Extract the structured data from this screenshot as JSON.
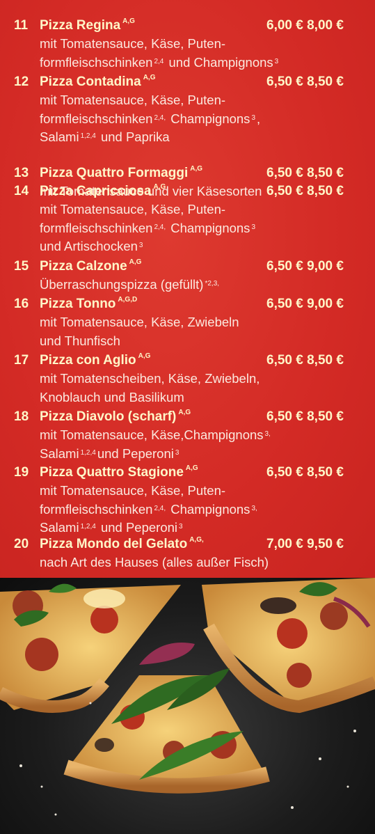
{
  "items": [
    {
      "num": "11",
      "name": "Pizza Regina",
      "allergens": "A,G",
      "price": "6,00 € 8,00 €",
      "lines": [
        [
          {
            "t": "mit Tomatensauce, Käse, Puten-"
          }
        ],
        [
          {
            "t": "formfleischschinken"
          },
          {
            "s": "2,4"
          },
          {
            "t": " und Champignons"
          },
          {
            "s": "3"
          }
        ]
      ]
    },
    {
      "num": "12",
      "name": "Pizza Contadina",
      "allergens": "A,G",
      "price": "6,50 € 8,50 €",
      "lines": [
        [
          {
            "t": "mit Tomatensauce, Käse, Puten-"
          }
        ],
        [
          {
            "t": "formfleischschinken"
          },
          {
            "s": "2,4,"
          },
          {
            "t": " Champignons"
          },
          {
            "s": "3"
          },
          {
            "t": ","
          }
        ],
        [
          {
            "t": "Salami"
          },
          {
            "s": "1,2,4"
          },
          {
            "t": " und Paprika"
          }
        ]
      ]
    },
    {
      "num": "13",
      "name": "Pizza Quattro Formaggi",
      "allergens": "A,G",
      "price": "6,50 € 8,50 €",
      "lines": [
        [
          {
            "t": "mit Tomatensauce und vier Käsesorten"
          }
        ]
      ]
    },
    {
      "num": "14",
      "name": "Pizza Capricciosa",
      "allergens": "A,G",
      "price": "6,50 € 8,50 €",
      "lines": [
        [
          {
            "t": "mit Tomatensauce, Käse, Puten-"
          }
        ],
        [
          {
            "t": "formfleischschinken"
          },
          {
            "s": "2,4,"
          },
          {
            "t": " Champignons"
          },
          {
            "s": "3"
          }
        ],
        [
          {
            "t": "und Artischocken"
          },
          {
            "s": "3"
          }
        ]
      ]
    },
    {
      "num": "15",
      "name": "Pizza Calzone",
      "allergens": "A,G",
      "price": "6,50 € 9,00 €",
      "lines": [
        [
          {
            "t": "Überraschungspizza (gefüllt)"
          },
          {
            "s": "*2,3,"
          }
        ]
      ]
    },
    {
      "num": "16",
      "name": "Pizza Tonno",
      "allergens": "A,G,D",
      "price": "6,50 € 9,00 €",
      "lines": [
        [
          {
            "t": "mit Tomatensauce, Käse, Zwiebeln"
          }
        ],
        [
          {
            "t": "und Thunfisch"
          }
        ]
      ]
    },
    {
      "num": "17",
      "name": "Pizza con Aglio",
      "allergens": "A,G",
      "price": "6,50 € 8,50 €",
      "lines": [
        [
          {
            "t": "mit Tomatenscheiben, Käse, Zwiebeln,"
          }
        ],
        [
          {
            "t": "Knoblauch und Basilikum"
          }
        ]
      ]
    },
    {
      "num": "18",
      "name": "Pizza Diavolo (scharf)",
      "allergens": "A,G",
      "price": "6,50 € 8,50 €",
      "lines": [
        [
          {
            "t": "mit Tomatensauce, Käse,Champignons"
          },
          {
            "s": "3,"
          }
        ],
        [
          {
            "t": "Salami"
          },
          {
            "s": "1,2,4"
          },
          {
            "t": "und Peperoni"
          },
          {
            "s": "3"
          }
        ]
      ]
    },
    {
      "num": "19",
      "name": "Pizza Quattro Stagione",
      "allergens": "A,G",
      "price": "6,50 € 8,50 €",
      "lines": [
        [
          {
            "t": "mit Tomatensauce, Käse, Puten-"
          }
        ],
        [
          {
            "t": "formfleischschinken"
          },
          {
            "s": "2,4,"
          },
          {
            "t": " Champignons"
          },
          {
            "s": "3,"
          }
        ],
        [
          {
            "t": "Salami"
          },
          {
            "s": "1,2,4"
          },
          {
            "t": " und Peperoni"
          },
          {
            "s": "3"
          }
        ]
      ]
    },
    {
      "num": "20",
      "name": "Pizza Mondo del Gelato",
      "allergens": "A,G,",
      "price": "7,00 € 9,50 €",
      "lines": [
        [
          {
            "t": "nach Art des Hauses (alles außer Fisch)"
          }
        ]
      ]
    }
  ]
}
